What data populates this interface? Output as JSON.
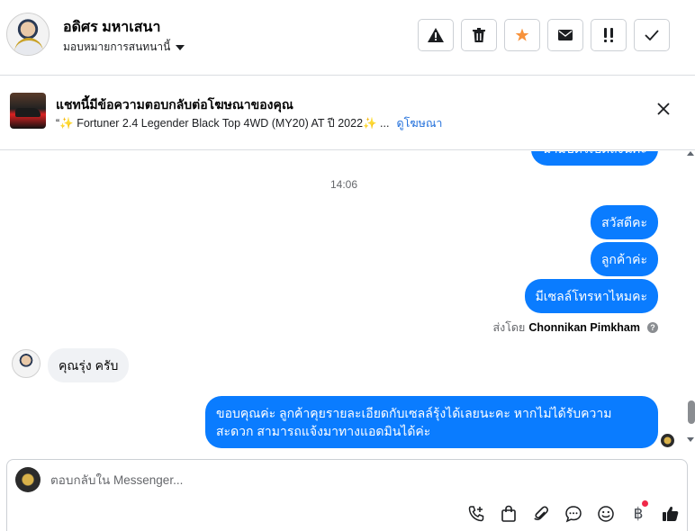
{
  "header": {
    "contact_name": "อดิศร มหาเสนา",
    "assign_label": "มอบหมายการสนทนานี้",
    "actions": [
      {
        "name": "spam-button",
        "icon": "warning-icon"
      },
      {
        "name": "delete-button",
        "icon": "trash-icon"
      },
      {
        "name": "star-button",
        "icon": "star-icon",
        "color": "#f7923b"
      },
      {
        "name": "mark-unread-button",
        "icon": "envelope-icon"
      },
      {
        "name": "follow-up-button",
        "icon": "double-exclamation-icon"
      },
      {
        "name": "mark-done-button",
        "icon": "check-icon"
      }
    ]
  },
  "ad": {
    "title": "แชทนี้มีข้อความตอบกลับต่อโฆษณาของคุณ",
    "subtitle": "“✨ Fortuner 2.4 Legender Black Top 4WD (MY20) AT ปี 2022✨ ...",
    "link": "ดูโฆษณา"
  },
  "chat": {
    "partial_message": "ฉามบัตรเปิดลงน้คะ",
    "timestamp": "14:06",
    "outgoing": [
      "สวัสดีคะ",
      "ลูกค้าค่ะ",
      "มีเซลล์โทรหาไหมคะ"
    ],
    "sent_by_prefix": "ส่งโดย",
    "sent_by_name": "Chonnikan Pimkham",
    "incoming": "คุณรุ่ง ครับ",
    "reply_line1": "ขอบคุณค่ะ ลูกค้าคุยรายละเอียดกับเซลล์รุ้งได้เลยนะคะ หากไม่ได้รับความ",
    "reply_line2": "สะดวก สามารถแจ้งมาทางแอดมินได้ค่ะ"
  },
  "composer": {
    "placeholder": "ตอบกลับใน Messenger...",
    "tools": [
      "call-icon",
      "shopping-bag-icon",
      "paperclip-icon",
      "saved-reply-icon",
      "emoji-icon",
      "baht-icon",
      "thumbs-up-icon"
    ],
    "baht_symbol": "฿"
  },
  "colors": {
    "accent": "#0a7cff",
    "link": "#216fdb",
    "star": "#f7923b"
  }
}
